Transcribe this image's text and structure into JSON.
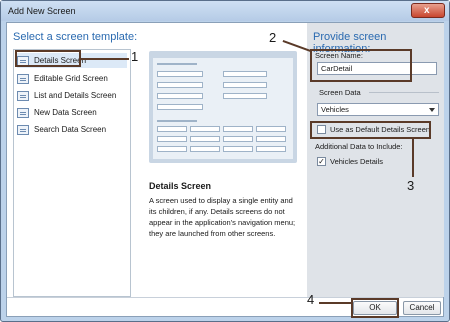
{
  "window": {
    "title": "Add New Screen",
    "close_glyph": "x"
  },
  "left": {
    "heading": "Select a screen template:",
    "templates": [
      {
        "label": "Details Screen",
        "icon": "details-screen-icon",
        "selected": true
      },
      {
        "label": "Editable Grid Screen",
        "icon": "grid-screen-icon",
        "selected": false
      },
      {
        "label": "List and Details Screen",
        "icon": "list-details-screen-icon",
        "selected": false
      },
      {
        "label": "New Data Screen",
        "icon": "new-data-screen-icon",
        "selected": false
      },
      {
        "label": "Search Data Screen",
        "icon": "search-data-screen-icon",
        "selected": false
      }
    ]
  },
  "description": {
    "title": "Details Screen",
    "text": "A screen used to display a single entity and its children, if any. Details screens do not appear in the application's navigation menu; they are launched from other screens."
  },
  "right": {
    "heading": "Provide screen information:",
    "screen_name_label": "Screen Name:",
    "screen_name_value": "CarDetail",
    "screen_data_label": "Screen Data",
    "screen_data_value": "Vehicles",
    "default_details_label": "Use as Default Details Screen",
    "default_details_checked": false,
    "additional_label": "Additional Data to Include:",
    "vehicle_details_label": "Vehicles Details",
    "vehicle_details_checked": true,
    "check_glyph": "✓"
  },
  "buttons": {
    "ok": "OK",
    "cancel": "Cancel"
  },
  "callouts": {
    "one": "1",
    "two": "2",
    "three": "3",
    "four": "4"
  },
  "colors": {
    "heading_blue": "#2a6ab0",
    "callout_brown": "#5a3a28",
    "right_panel_bg": "#dfe3e8"
  }
}
